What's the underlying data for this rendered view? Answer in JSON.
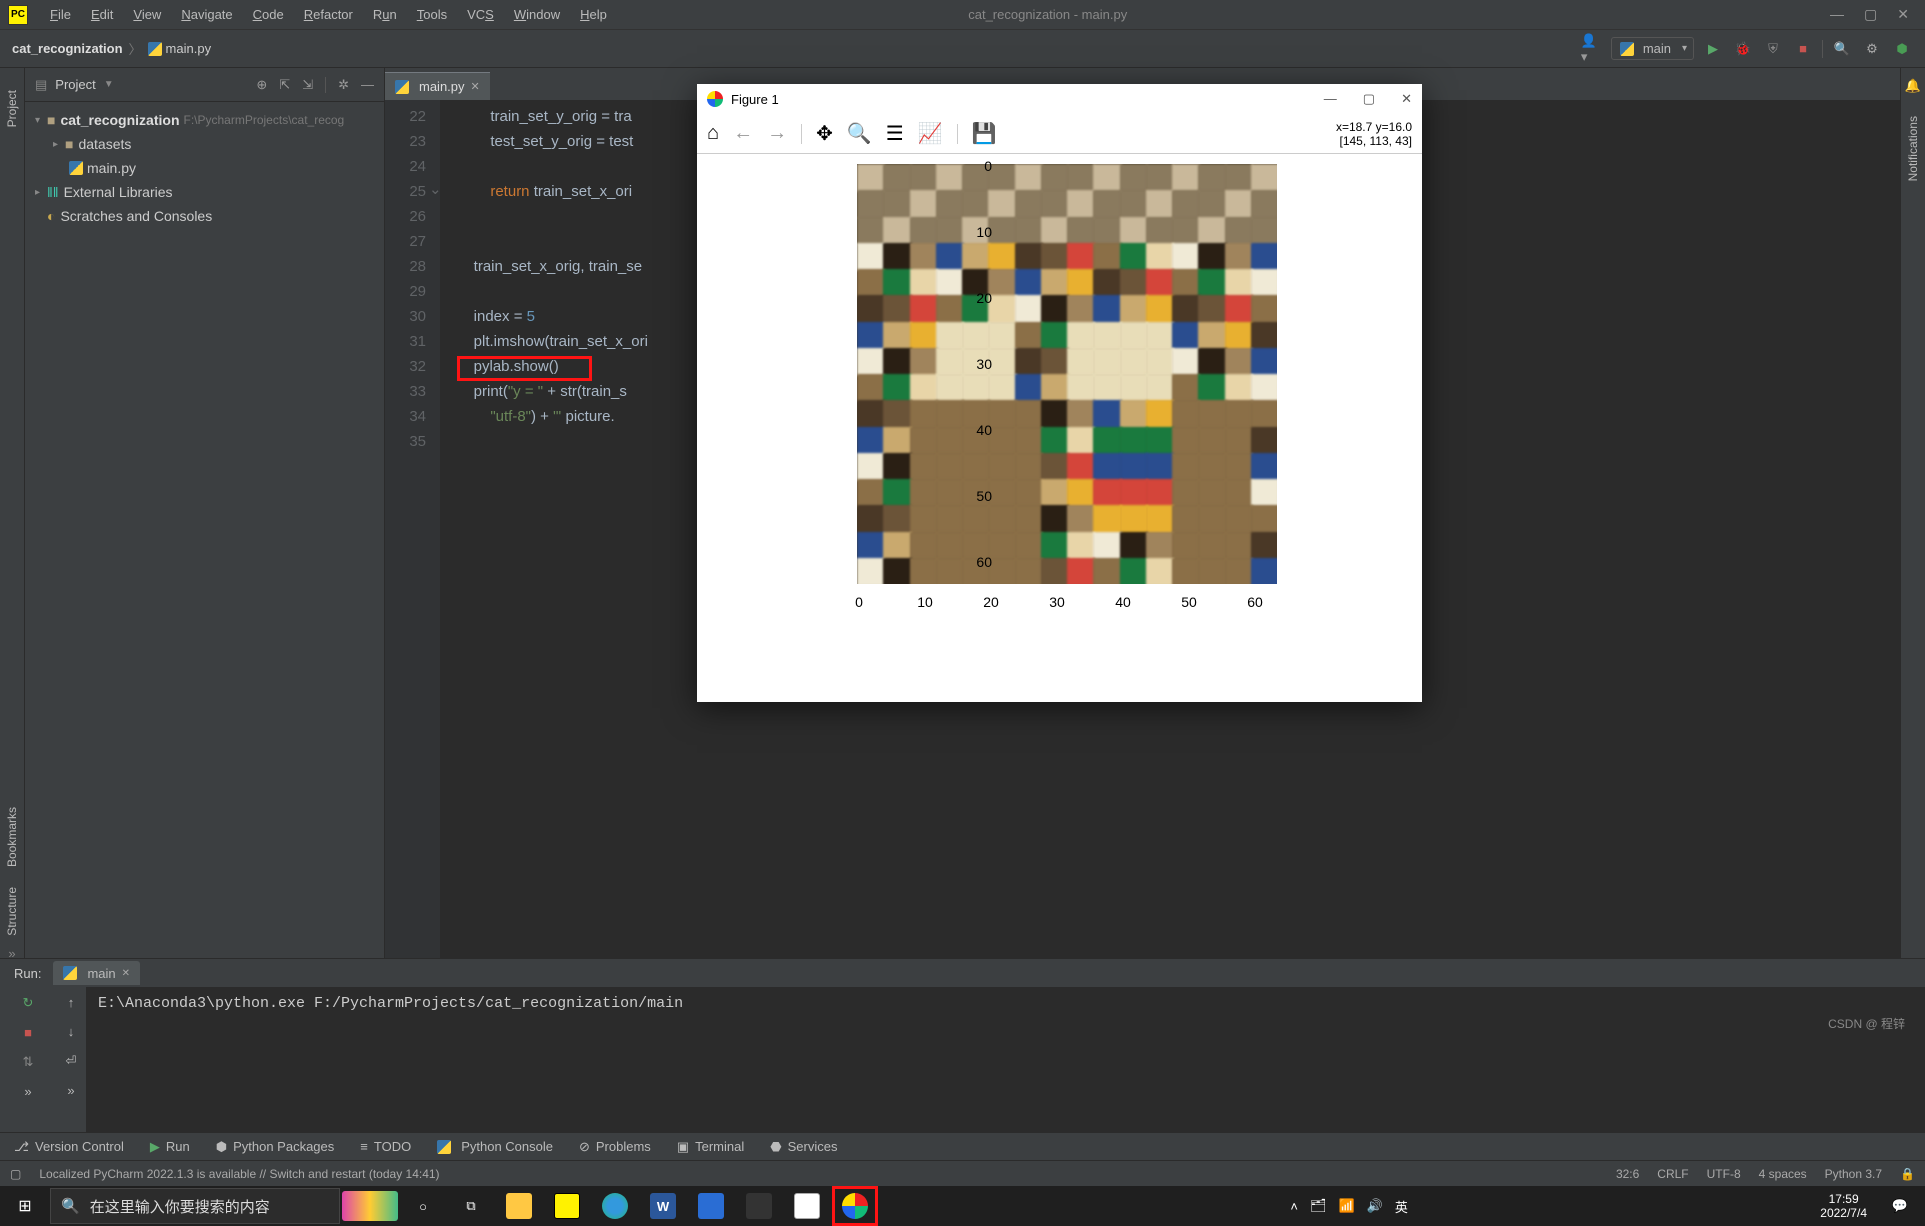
{
  "window": {
    "title": "cat_recognization - main.py"
  },
  "menu": [
    "File",
    "Edit",
    "View",
    "Navigate",
    "Code",
    "Refactor",
    "Run",
    "Tools",
    "VCS",
    "Window",
    "Help"
  ],
  "breadcrumbs": {
    "project": "cat_recognization",
    "file": "main.py"
  },
  "run_config": {
    "name": "main"
  },
  "project_panel": {
    "title": "Project",
    "tree": {
      "root": {
        "name": "cat_recognization",
        "path": "F:\\PycharmProjects\\cat_recog"
      },
      "datasets": "datasets",
      "mainpy": "main.py",
      "ext_lib": "External Libraries",
      "scratches": "Scratches and Consoles"
    }
  },
  "tabs": {
    "active": "main.py"
  },
  "code": {
    "start_line": 22,
    "lines": [
      "        train_set_y_orig = tra",
      "        test_set_y_orig = test",
      "",
      "        return train_set_x_ori",
      "",
      "",
      "    train_set_x_orig, train_se",
      "",
      "    index = 5",
      "    plt.imshow(train_set_x_ori",
      "    pylab.show()",
      "    print(\"y = \" + str(train_s",
      "        \"utf-8\") + \"' picture.",
      ""
    ]
  },
  "run": {
    "label": "Run:",
    "tab": "main",
    "output": "E:\\Anaconda3\\python.exe F:/PycharmProjects/cat_recognization/main"
  },
  "bottom_tools": [
    "Version Control",
    "Run",
    "Python Packages",
    "TODO",
    "Python Console",
    "Problems",
    "Terminal",
    "Services"
  ],
  "status": {
    "msg": "Localized PyCharm 2022.1.3 is available // Switch and restart (today 14:41)",
    "pos": "32:6",
    "crlf": "CRLF",
    "enc": "UTF-8",
    "indent": "4 spaces",
    "python": "Python 3.7"
  },
  "sidebars": {
    "left": [
      "Project",
      "Bookmarks",
      "Structure"
    ],
    "right": "Notifications"
  },
  "mpl": {
    "title": "Figure 1",
    "coord_line1": "x=18.7 y=16.0",
    "coord_line2": "[145, 113, 43]",
    "yticks": [
      "0",
      "10",
      "20",
      "30",
      "40",
      "50",
      "60"
    ],
    "xticks": [
      "0",
      "10",
      "20",
      "30",
      "40",
      "50",
      "60"
    ]
  },
  "taskbar": {
    "search_placeholder": "在这里输入你要搜索的内容",
    "ime": "英",
    "time": "17:59",
    "date": "2022/7/4"
  },
  "watermark": "CSDN @ 程锌"
}
